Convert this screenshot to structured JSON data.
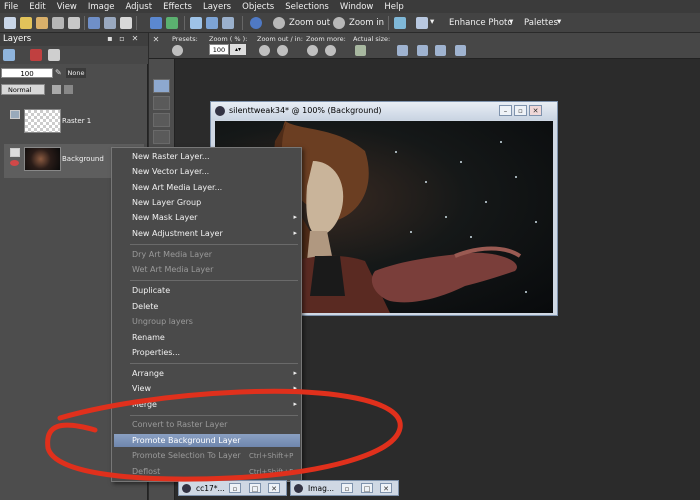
{
  "menubar": [
    "File",
    "Edit",
    "View",
    "Image",
    "Adjust",
    "Effects",
    "Layers",
    "Objects",
    "Selections",
    "Window",
    "Help"
  ],
  "toolbar": {
    "zoom_out": "Zoom out",
    "zoom_in": "Zoom in",
    "enhance_photo": "Enhance Photo",
    "palettes": "Palettes"
  },
  "tool_options": {
    "presets": "Presets:",
    "zoom_pct": "Zoom ( % ):",
    "zoom_value": "100",
    "zoom_out_in": "Zoom out / in:",
    "zoom_more": "Zoom more:",
    "actual_size": "Actual size:"
  },
  "layers_panel": {
    "title": "Layers",
    "opacity": "100",
    "mask_label": "None",
    "blend_mode": "Normal",
    "layers": [
      {
        "name": "Raster 1"
      },
      {
        "name": "Background"
      }
    ]
  },
  "document": {
    "title": "silenttweak34* @ 100% (Background)"
  },
  "context_menu": {
    "items": [
      {
        "label": "New Raster Layer...",
        "disabled": false
      },
      {
        "label": "New Vector Layer...",
        "disabled": false
      },
      {
        "label": "New Art Media Layer...",
        "disabled": false
      },
      {
        "label": "New Layer Group",
        "disabled": false
      },
      {
        "label": "New Mask Layer",
        "disabled": false,
        "submenu": true
      },
      {
        "label": "New Adjustment Layer",
        "disabled": false,
        "submenu": true
      },
      {
        "label": "Dry Art Media Layer",
        "disabled": true
      },
      {
        "label": "Wet Art Media Layer",
        "disabled": true
      },
      {
        "label": "Duplicate",
        "disabled": false
      },
      {
        "label": "Delete",
        "disabled": false
      },
      {
        "label": "Ungroup layers",
        "disabled": true
      },
      {
        "label": "Rename",
        "disabled": false
      },
      {
        "label": "Properties...",
        "disabled": false
      },
      {
        "label": "Arrange",
        "disabled": false,
        "submenu": true
      },
      {
        "label": "View",
        "disabled": false,
        "submenu": true
      },
      {
        "label": "Merge",
        "disabled": false,
        "submenu": true
      },
      {
        "label": "Convert to Raster Layer",
        "disabled": true
      },
      {
        "label": "Promote Background Layer",
        "disabled": false,
        "highlighted": true
      },
      {
        "label": "Promote Selection To Layer",
        "disabled": true,
        "shortcut": "Ctrl+Shift+P"
      },
      {
        "label": "Deflost",
        "disabled": true,
        "shortcut": "Ctrl+Shift+F"
      }
    ]
  },
  "minimized_windows": [
    {
      "title": "cc17*..."
    },
    {
      "title": "Imag..."
    }
  ],
  "colors": {
    "annotation": "#e0301c",
    "highlight": "#7d93b8",
    "menu_bg": "#4a4a4a"
  }
}
